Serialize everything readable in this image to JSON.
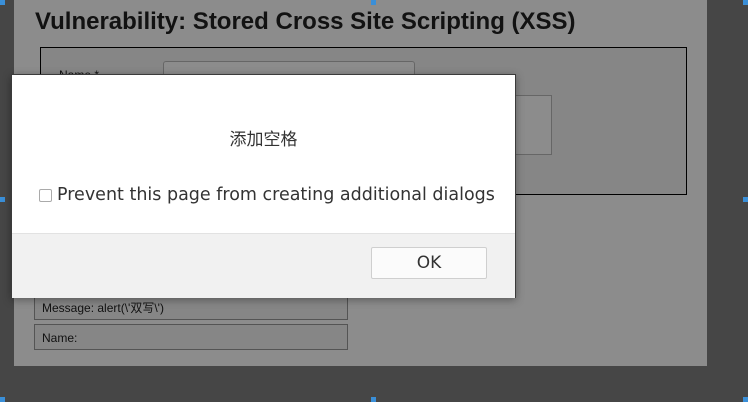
{
  "page": {
    "title": "Vulnerability: Stored Cross Site Scripting (XSS)",
    "form": {
      "name_label": "Name *"
    },
    "entries": [
      "Message: alert(\\'双写\\')",
      "Name:"
    ]
  },
  "dialog": {
    "message": "添加空格",
    "prevent_label": "Prevent this page from creating additional dialogs",
    "prevent_checked": false,
    "ok_label": "OK"
  },
  "colors": {
    "overlay": "#808080",
    "dialog_footer": "#f1f1f1",
    "handle": "#3a8fd8"
  }
}
